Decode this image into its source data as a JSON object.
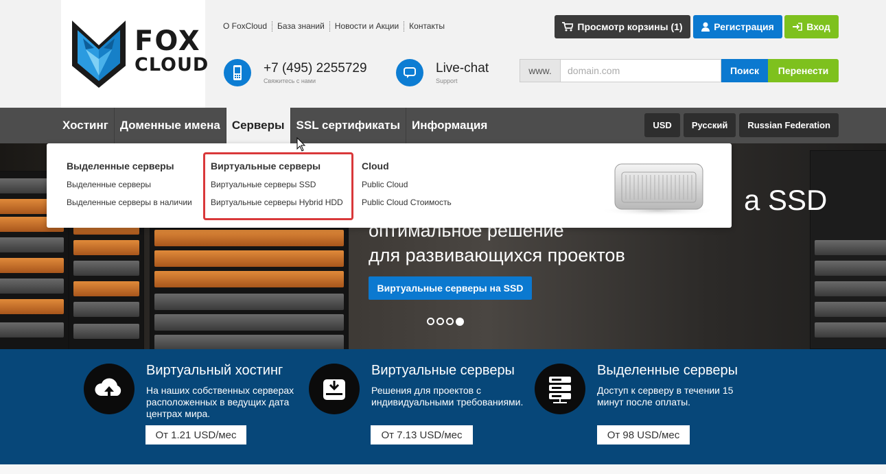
{
  "logo": {
    "line1": "FOX",
    "line2": "CLOUD"
  },
  "top_links": [
    "О FoxCloud",
    "База знаний",
    "Новости и Акции",
    "Контакты"
  ],
  "phone": {
    "number": "+7 (495) 2255729",
    "caption": "Свяжитесь с нами"
  },
  "chat": {
    "label": "Live-chat",
    "caption": "Support"
  },
  "buttons": {
    "cart": "Просмотр корзины (1)",
    "register": "Регистрация",
    "login": "Вход"
  },
  "domain": {
    "prefix": "www.",
    "placeholder": "domain.com",
    "search": "Поиск",
    "transfer": "Перенести"
  },
  "nav": {
    "items": [
      "Хостинг",
      "Доменные имена",
      "Серверы",
      "SSL сертификаты",
      "Информация"
    ],
    "active": "Серверы",
    "currency": "USD",
    "language": "Русский",
    "region": "Russian Federation"
  },
  "dropdown": {
    "col1": {
      "title": "Выделенные серверы",
      "links": [
        "Выделенные серверы",
        "Выделенные серверы в наличии"
      ]
    },
    "col2": {
      "title": "Виртуальные серверы",
      "links": [
        "Виртуальные серверы SSD",
        "Виртуальные серверы Hybrid HDD"
      ]
    },
    "col3": {
      "title": "Cloud",
      "links": [
        "Public Cloud",
        "Public Cloud Стоимость"
      ]
    }
  },
  "hero": {
    "ssd_fragment": "a SSD",
    "line1": "оптимальное решение",
    "line2": "для развивающихся проектов",
    "button": "Виртуальные серверы на SSD",
    "active_slide": 4,
    "slides_total": 4
  },
  "features": [
    {
      "title": "Виртуальный хостинг",
      "desc": "На наших собственных серверах расположенных в ведущих дата центрах мира.",
      "price": "От 1.21 USD/мес",
      "icon": "cloud-upload-icon"
    },
    {
      "title": "Виртуальные серверы",
      "desc": "Решения для проектов с индивидуальными требованиями.",
      "price": "От 7.13 USD/мес",
      "icon": "server-download-icon"
    },
    {
      "title": "Выделенные серверы",
      "desc": "Доступ к серверу в течении 15 минут после оплаты.",
      "price": "От 98 USD/мес",
      "icon": "server-stack-icon"
    }
  ],
  "colors": {
    "primary": "#0b79d0",
    "green": "#7ec11e",
    "dark": "#3a3a3a",
    "nav": "#4d4d4d",
    "footer_band": "#074779",
    "highlight": "#d9383a"
  }
}
